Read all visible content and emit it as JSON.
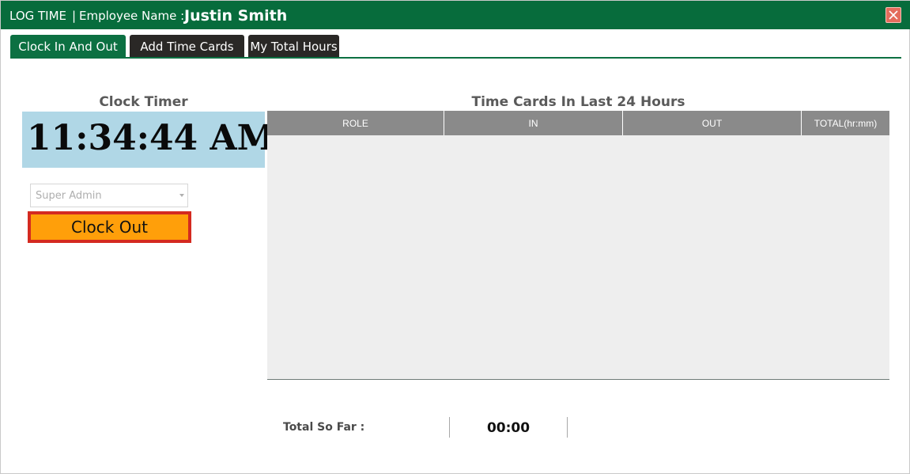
{
  "titlebar": {
    "app_title": "LOG TIME",
    "separator": "|",
    "employee_label": "Employee Name :",
    "employee_name": "Justin Smith",
    "close_icon": "close-icon"
  },
  "tabs": [
    {
      "label": "Clock In And Out",
      "active": true
    },
    {
      "label": "Add Time Cards",
      "active": false
    },
    {
      "label": "My Total Hours",
      "active": false
    }
  ],
  "clock": {
    "heading": "Clock Timer",
    "time": "11:34:44 AM"
  },
  "role_select": {
    "value": "Super Admin"
  },
  "clock_out_button": {
    "label": "Clock Out"
  },
  "time_cards": {
    "heading": "Time Cards In Last 24 Hours",
    "columns": [
      "ROLE",
      "IN",
      "OUT",
      "TOTAL(hr:mm)"
    ],
    "rows": []
  },
  "totals": {
    "label": "Total So Far :",
    "value": "00:00"
  },
  "colors": {
    "titlebar": "#076c3c",
    "tab_active": "#0c7042",
    "tab_inactive": "#2a2826",
    "clock_bg": "#b0d7e6",
    "clockout_bg": "#ff9f0a",
    "clockout_border": "#d42a20",
    "table_header": "#8a8a8a",
    "table_body": "#eeeeee"
  }
}
